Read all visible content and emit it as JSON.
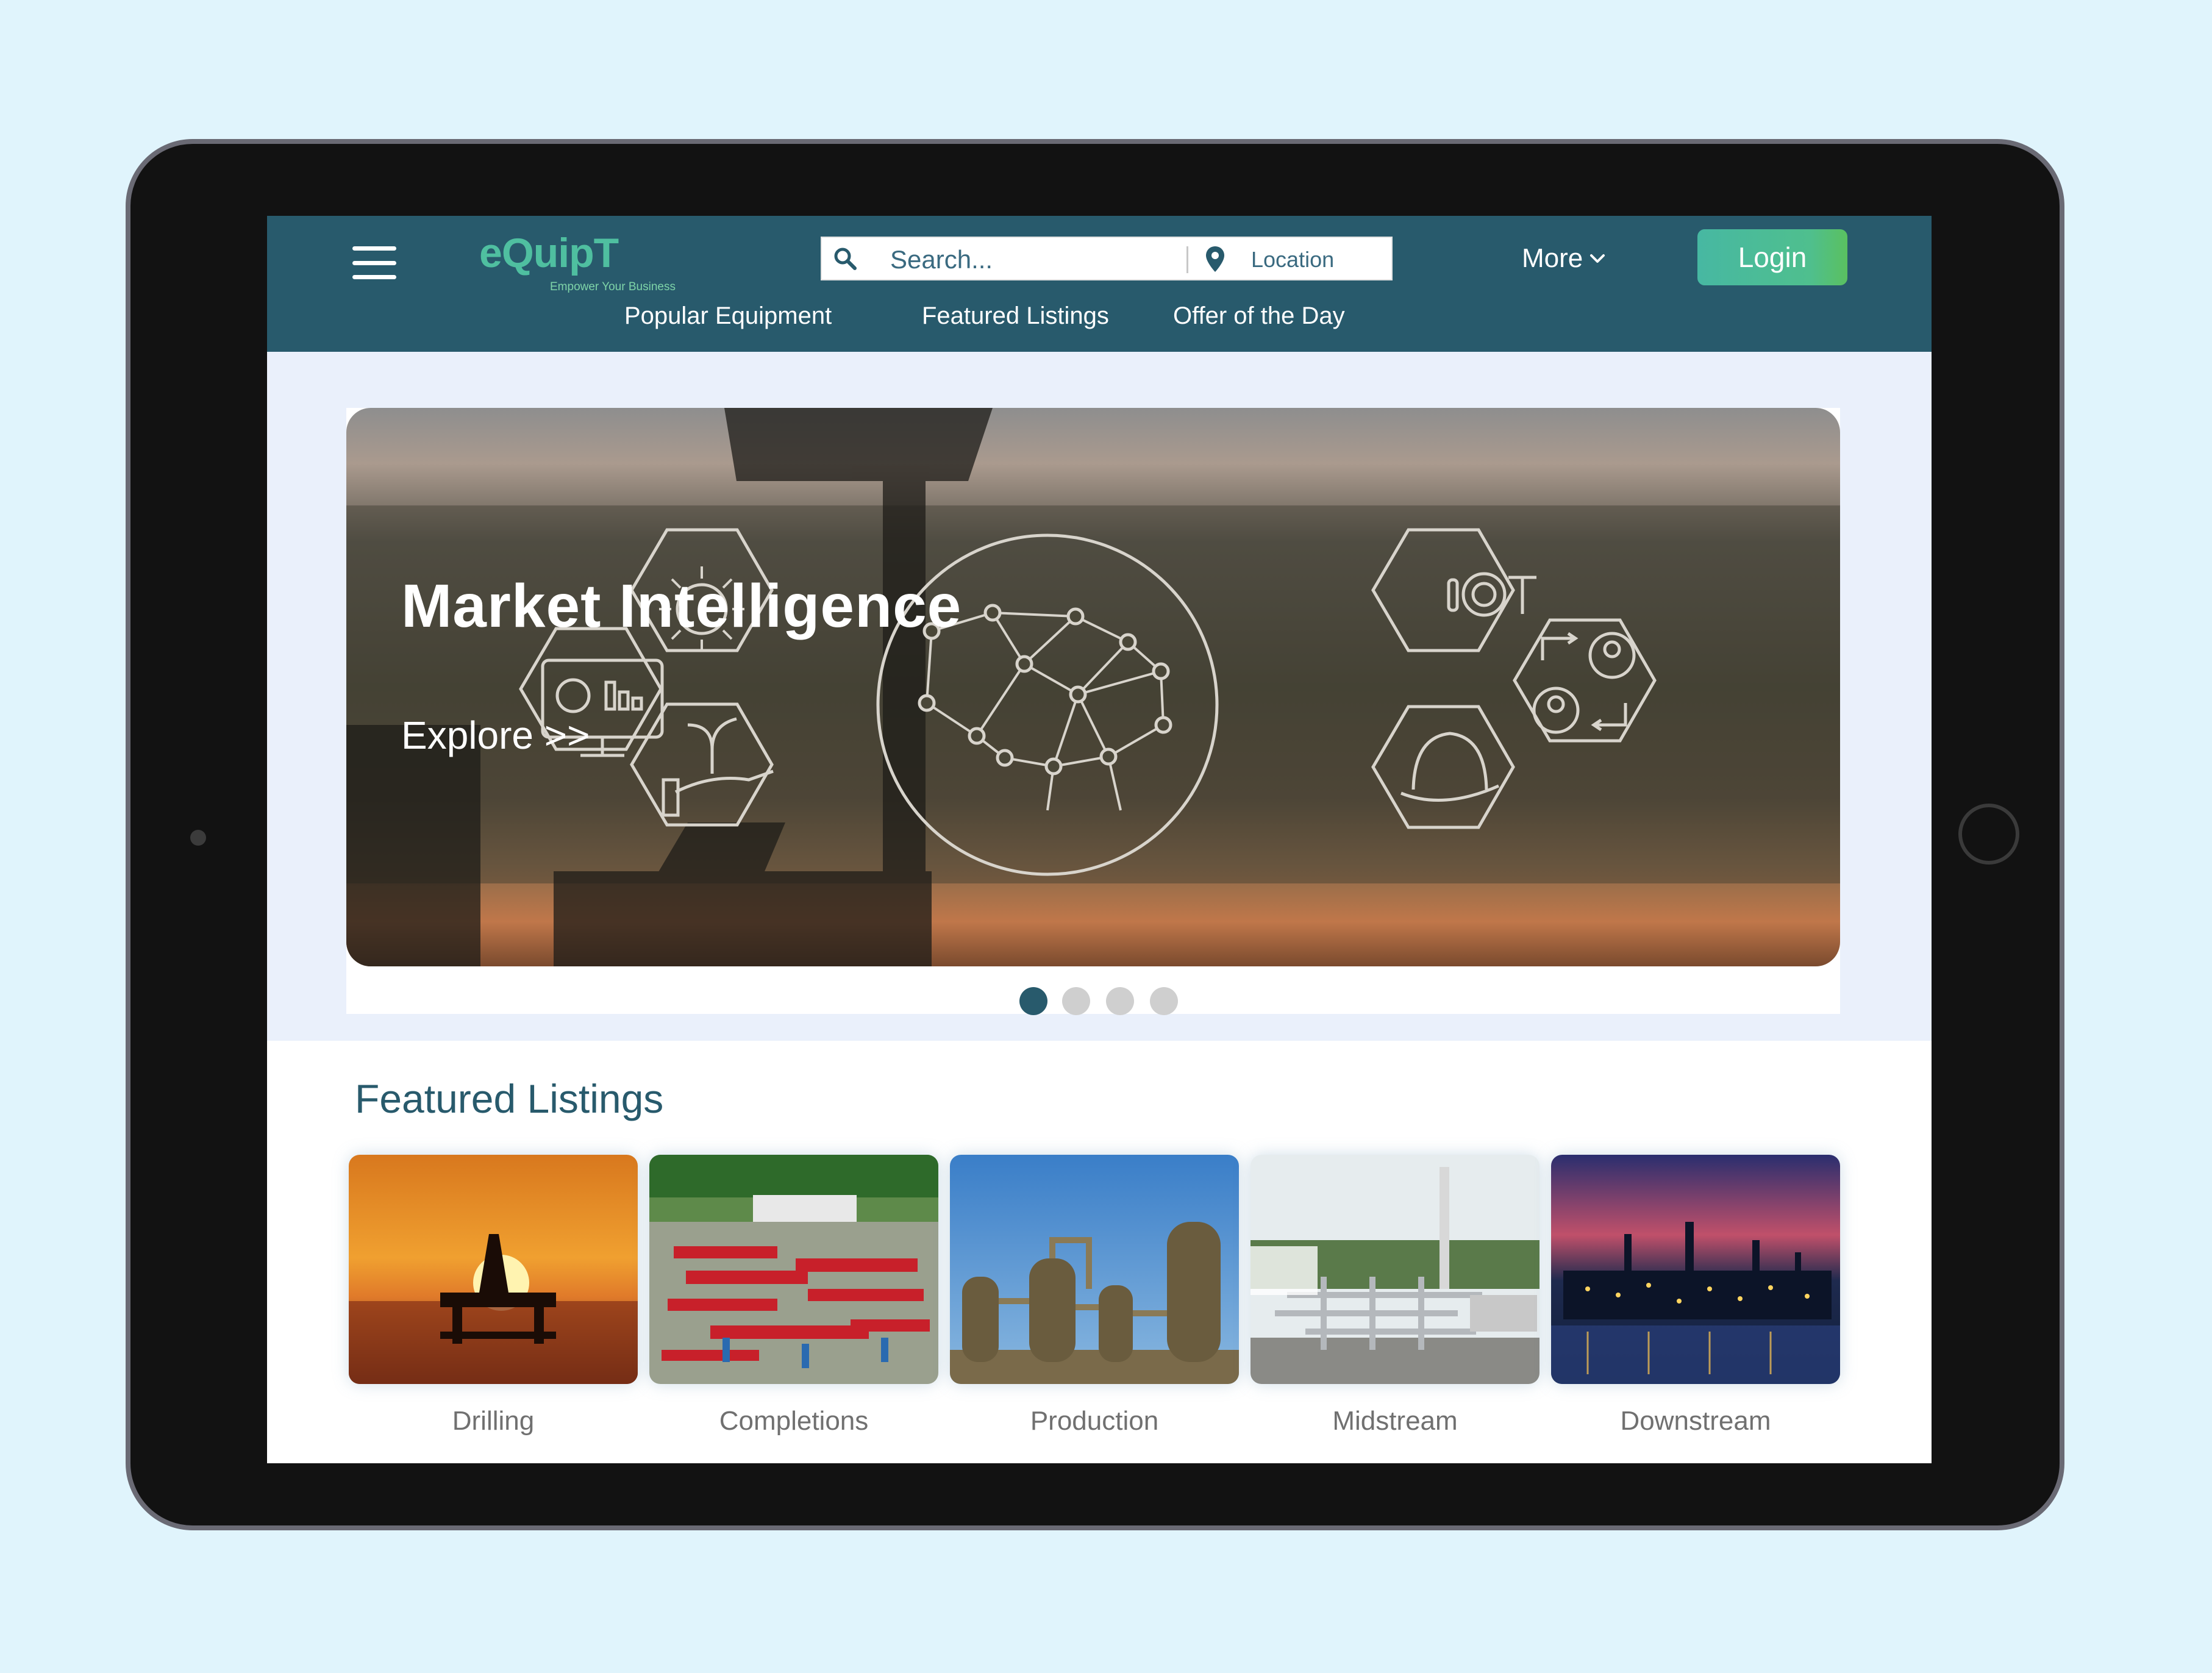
{
  "brand": {
    "logo_text": "eQuipT",
    "tagline": "Empower Your Business"
  },
  "header": {
    "menu_icon": "hamburger-menu-icon",
    "search": {
      "placeholder": "Search...",
      "icon": "search-icon"
    },
    "location": {
      "placeholder": "Location",
      "icon": "location-pin-icon"
    },
    "more_label": "More",
    "login_label": "Login",
    "nav_links": [
      "Popular Equipment",
      "Featured Listings",
      "Offer of the Day"
    ]
  },
  "hero": {
    "title": "Market Intelligence",
    "cta": "Explore >>",
    "slides_total": 4,
    "active_slide": 1,
    "icon_labels": [
      "IOT"
    ]
  },
  "featured": {
    "heading": "Featured Listings",
    "cards": [
      {
        "label": "Drilling"
      },
      {
        "label": "Completions"
      },
      {
        "label": "Production"
      },
      {
        "label": "Midstream"
      },
      {
        "label": "Downstream"
      }
    ]
  },
  "colors": {
    "page_background": "#e0f4fc",
    "header_background": "#285a6c",
    "login_button": "#4fbf8e",
    "brand_green": "#4fbfa0",
    "heading_text": "#285a6c",
    "active_dot": "#285a6c",
    "inactive_dot": "#cfcfcf"
  }
}
